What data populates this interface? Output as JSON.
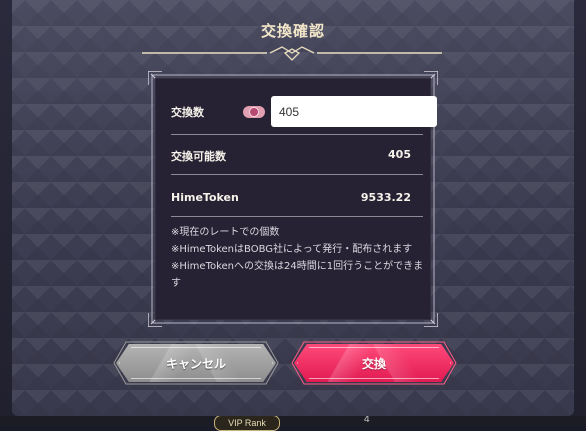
{
  "dialog": {
    "title": "交換確認"
  },
  "panel": {
    "exchange_amount_label": "交換数",
    "exchange_amount_value": "405",
    "exchangeable_label": "交換可能数",
    "exchangeable_value": "405",
    "hime_token_label": "HimeToken",
    "hime_token_value": "9533.22",
    "notes": [
      "※現在のレートでの個数",
      "※HimeTokenはBOBG社によって発行・配布されます",
      "※HimeTokenへの交換は24時間に1回行うことができます"
    ]
  },
  "buttons": {
    "cancel_label": "キャンセル",
    "exchange_label": "交換"
  },
  "background": {
    "vip_rank_label": "VIP Rank",
    "vip_rank_value": "4"
  },
  "icons": {
    "token": "token-coin-icon",
    "title_ornament": "ornament-divider-icon"
  },
  "colors": {
    "modal_bg": "#44445a",
    "panel_bg": "#272233",
    "title": "#f1e6c8",
    "exchange_button": "#f02a60",
    "cancel_button": "#a0a0a0"
  }
}
